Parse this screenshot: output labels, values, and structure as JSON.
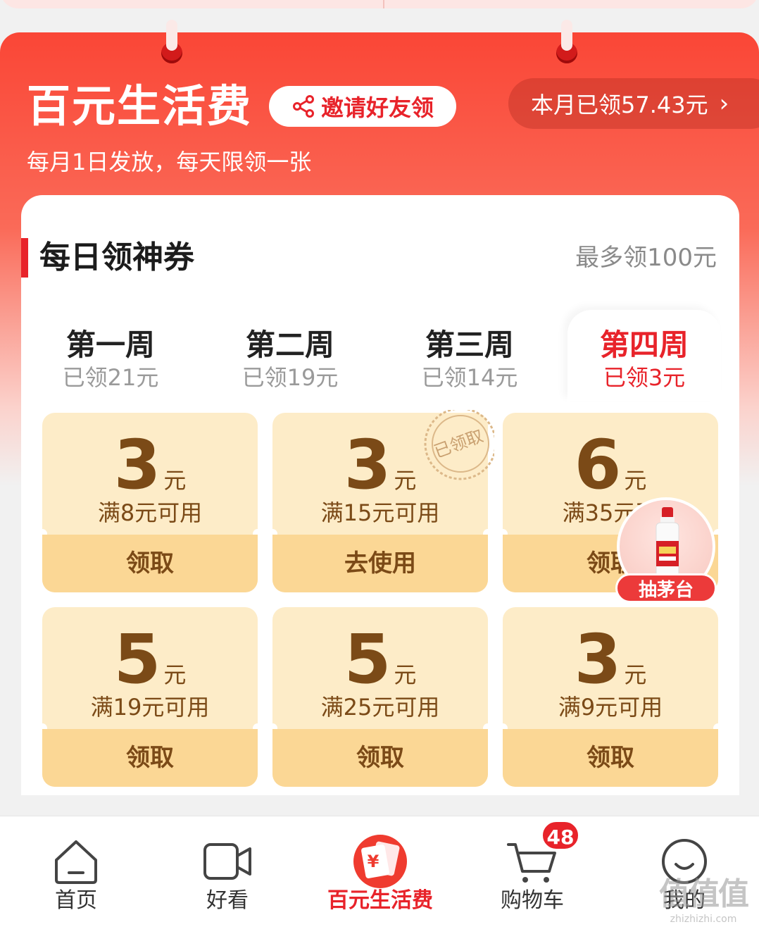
{
  "header": {
    "title": "百元生活费",
    "invite_label": "邀请好友领",
    "monthly_claimed": "本月已领57.43元",
    "subtitle": "每月1日发放，每天限领一张"
  },
  "section": {
    "title": "每日领神券",
    "max_note": "最多领100元"
  },
  "weeks": [
    {
      "name": "第一周",
      "claimed": "已领21元"
    },
    {
      "name": "第二周",
      "claimed": "已领19元"
    },
    {
      "name": "第三周",
      "claimed": "已领14元"
    },
    {
      "name": "第四周",
      "claimed": "已领3元"
    }
  ],
  "active_week_index": 3,
  "coupons": [
    {
      "amount": "3",
      "unit": "元",
      "condition": "满8元可用",
      "action": "领取"
    },
    {
      "amount": "3",
      "unit": "元",
      "condition": "满15元可用",
      "action": "去使用",
      "stamp": "已领取"
    },
    {
      "amount": "6",
      "unit": "元",
      "condition": "满35元可",
      "action": "领取"
    },
    {
      "amount": "5",
      "unit": "元",
      "condition": "满19元可用",
      "action": "领取"
    },
    {
      "amount": "5",
      "unit": "元",
      "condition": "满25元可用",
      "action": "领取"
    },
    {
      "amount": "3",
      "unit": "元",
      "condition": "满9元可用",
      "action": "领取"
    }
  ],
  "promo_badge": {
    "label": "抽茅台",
    "icon": "moutai-bottle-icon"
  },
  "bottom_nav": {
    "items": [
      {
        "label": "首页",
        "icon": "home-icon"
      },
      {
        "label": "好看",
        "icon": "video-icon"
      },
      {
        "label": "百元生活费",
        "icon": "living-allowance-icon"
      },
      {
        "label": "购物车",
        "icon": "cart-icon"
      },
      {
        "label": "我的",
        "icon": "profile-icon"
      }
    ],
    "active_index": 2,
    "cart_badge": "48"
  },
  "watermark": {
    "main": "值值值",
    "sub": "zhizhizhi.com"
  },
  "colors": {
    "accent_red": "#e8232a",
    "coupon_bg": "#fdecc8",
    "coupon_button": "#fbd795",
    "coupon_text": "#7b4a17"
  }
}
